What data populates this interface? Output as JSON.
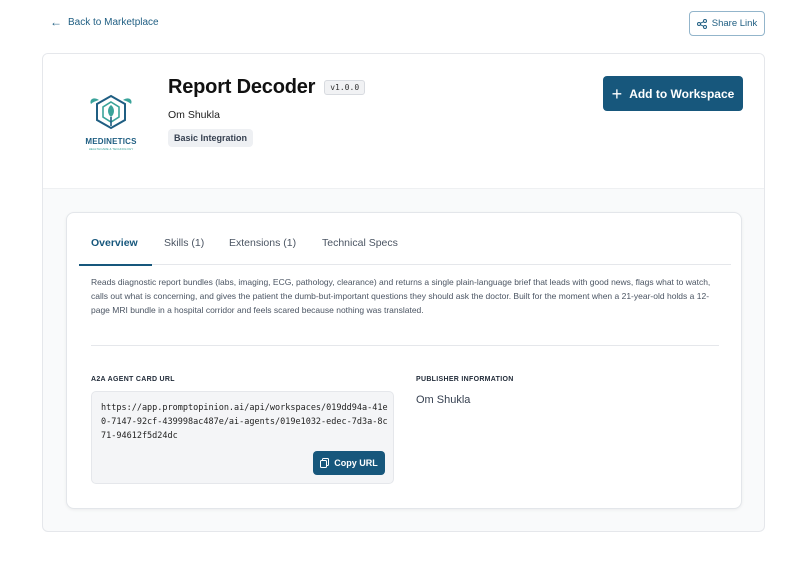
{
  "nav": {
    "back_label": "Back to Marketplace",
    "share_label": "Share Link"
  },
  "agent": {
    "title": "Report Decoder",
    "version": "v1.0.0",
    "author": "Om Shukla",
    "badge": "Basic Integration",
    "add_label": "Add to Workspace"
  },
  "logo": {
    "word": "MEDINETICS",
    "tagline": "HEALTHCARE & TECHNOLOGY"
  },
  "tabs": [
    {
      "label": "Overview",
      "active": true
    },
    {
      "label": "Skills (1)",
      "active": false
    },
    {
      "label": "Extensions (1)",
      "active": false
    },
    {
      "label": "Technical Specs",
      "active": false
    }
  ],
  "overview": {
    "description": "Reads diagnostic report bundles (labs, imaging, ECG, pathology, clearance) and returns a single plain-language brief that leads with good news, flags what to watch, calls out what is concerning, and gives the patient the dumb-but-important questions they should ask the doctor. Built for the moment when a 21-year-old holds a 12-page MRI bundle in a hospital corridor and feels scared because nothing was translated.",
    "card_url_label": "A2A AGENT CARD URL",
    "card_url": "https://app.promptopinion.ai/api/workspaces/019dd94a-41e0-7147-92cf-439998ac487e/ai-agents/019e1032-edec-7d3a-8c71-94612f5d24dc",
    "copy_label": "Copy URL",
    "publisher_label": "PUBLISHER INFORMATION",
    "publisher_name": "Om Shukla"
  },
  "colors": {
    "primary": "#17577c",
    "accent_teal": "#3aa39a",
    "link": "#1f5e82"
  }
}
